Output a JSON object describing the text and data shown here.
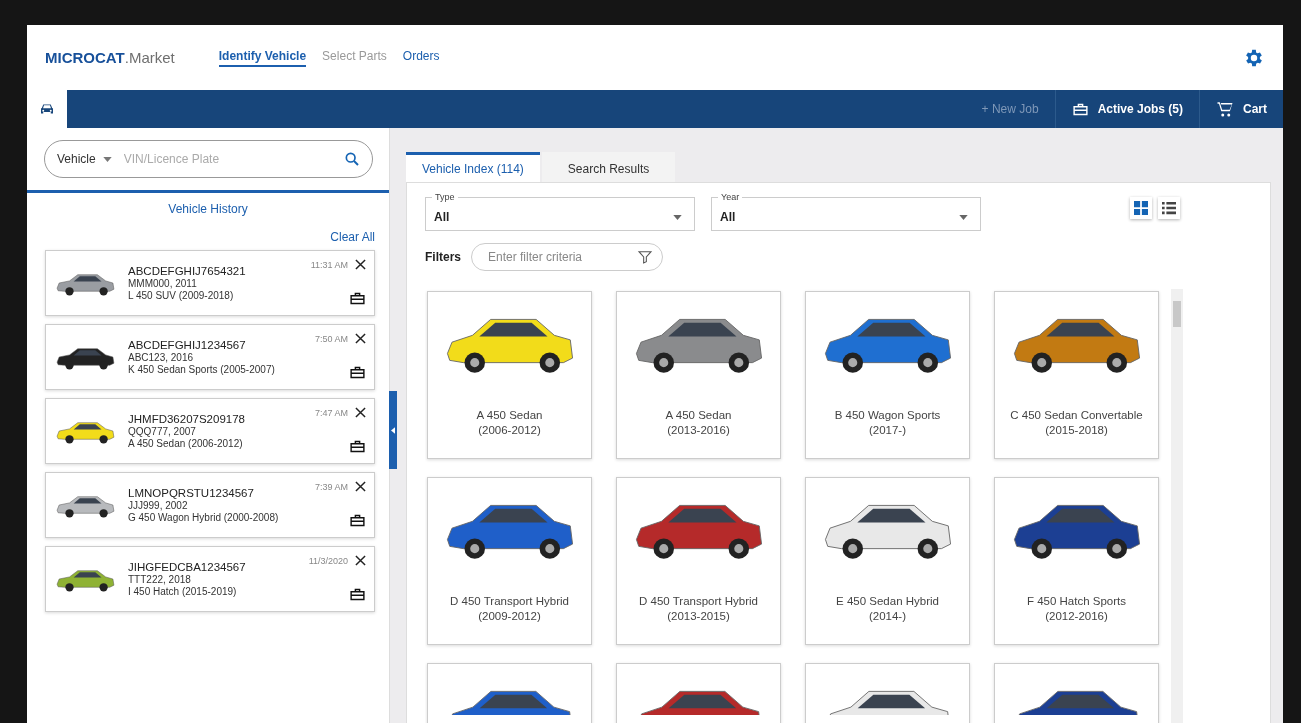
{
  "logo": {
    "brand": "MICROCAT",
    "suffix": ".Market"
  },
  "nav": [
    {
      "label": "Identify Vehicle",
      "selected": true,
      "disabled": false
    },
    {
      "label": "Select Parts",
      "selected": false,
      "disabled": true
    },
    {
      "label": "Orders",
      "selected": false,
      "disabled": false
    }
  ],
  "toolbar": {
    "new_job": {
      "label": "+ New Job",
      "disabled": true
    },
    "active_jobs": "Active Jobs (5)",
    "cart": "Cart"
  },
  "search": {
    "mode": "Vehicle",
    "placeholder": "VIN/Licence Plate"
  },
  "history": {
    "title": "Vehicle History",
    "clear": "Clear All",
    "items": [
      {
        "vin": "ABCDEFGHIJ7654321",
        "plate": "MMM000, 2011",
        "model": "L 450 SUV (2009-2018)",
        "time": "11:31 AM",
        "color": "#9a9da2"
      },
      {
        "vin": "ABCDEFGHIJ1234567",
        "plate": "ABC123, 2016",
        "model": "K 450 Sedan Sports (2005-2007)",
        "time": "7:50 AM",
        "color": "#222222"
      },
      {
        "vin": "JHMFD36207S209178",
        "plate": "QQQ777, 2007",
        "model": "A 450 Sedan (2006-2012)",
        "time": "7:47 AM",
        "color": "#f2dc1a"
      },
      {
        "vin": "LMNOPQRSTU1234567",
        "plate": "JJJ999, 2002",
        "model": "G 450 Wagon Hybrid (2000-2008)",
        "time": "7:39 AM",
        "color": "#b8babd"
      },
      {
        "vin": "JIHGFEDCBA1234567",
        "plate": "TTT222, 2018",
        "model": "I 450 Hatch (2015-2019)",
        "time": "11/3/2020",
        "color": "#8fb234"
      }
    ]
  },
  "tabs": [
    {
      "label": "Vehicle Index (114)",
      "selected": true
    },
    {
      "label": "Search Results",
      "selected": false
    }
  ],
  "selects": [
    {
      "label": "Type",
      "value": "All"
    },
    {
      "label": "Year",
      "value": "All"
    }
  ],
  "views": [
    {
      "kind": "grid",
      "selected": true
    },
    {
      "kind": "list",
      "selected": false
    }
  ],
  "filters": {
    "label": "Filters",
    "placeholder": "Enter filter criteria"
  },
  "vehicles": [
    {
      "name": "A 450 Sedan",
      "years": "(2006-2012)",
      "color": "#f2dc1a"
    },
    {
      "name": "A 450 Sedan",
      "years": "(2013-2016)",
      "color": "#8a8b8d"
    },
    {
      "name": "B 450 Wagon Sports",
      "years": "(2017-)",
      "color": "#1f6fd1"
    },
    {
      "name": "C 450 Sedan Convertable",
      "years": "(2015-2018)",
      "color": "#c27a12"
    },
    {
      "name": "D 450 Transport Hybrid",
      "years": "(2009-2012)",
      "color": "#1f5fc9"
    },
    {
      "name": "D 450 Transport Hybrid",
      "years": "(2013-2015)",
      "color": "#b52a2a"
    },
    {
      "name": "E 450 Sedan Hybrid",
      "years": "(2014-)",
      "color": "#e8e8e8"
    },
    {
      "name": "F 450 Hatch Sports",
      "years": "(2012-2016)",
      "color": "#1c3f93"
    },
    {
      "color": "#1f5fc9"
    },
    {
      "color": "#b52a2a"
    },
    {
      "color": "#e8e8e8"
    },
    {
      "color": "#1c3f93"
    }
  ]
}
